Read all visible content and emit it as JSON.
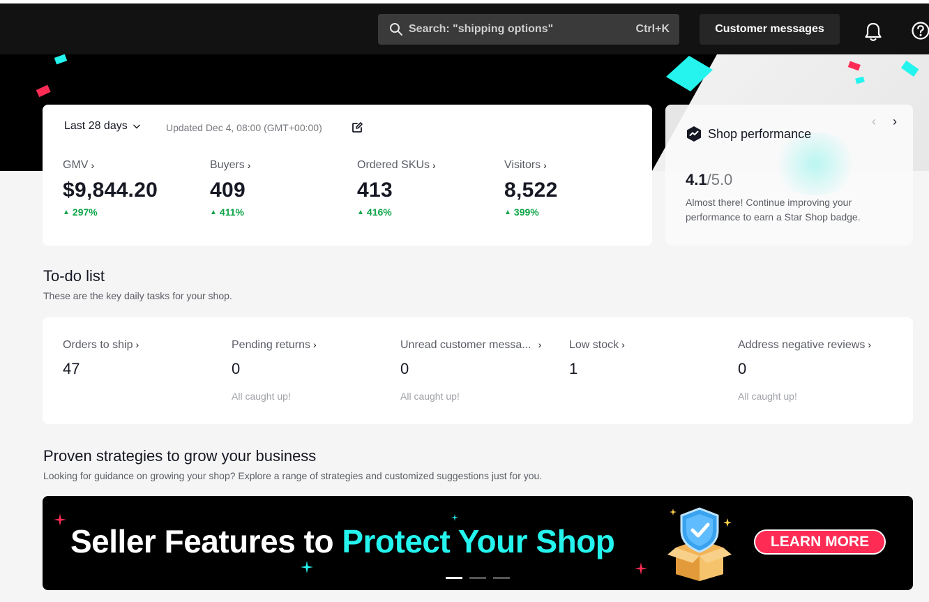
{
  "topbar": {
    "search_placeholder": "Search: \"shipping options\"",
    "search_shortcut": "Ctrl+K",
    "messages_label": "Customer messages",
    "icons": [
      "search-icon",
      "bell-icon",
      "help-icon"
    ]
  },
  "stats": {
    "range_label": "Last 28 days",
    "updated_label": "Updated Dec 4, 08:00 (GMT+00:00)",
    "metrics": [
      {
        "label": "GMV",
        "value": "$9,844.20",
        "delta": "297%"
      },
      {
        "label": "Buyers",
        "value": "409",
        "delta": "411%"
      },
      {
        "label": "Ordered SKUs",
        "value": "413",
        "delta": "416%"
      },
      {
        "label": "Visitors",
        "value": "8,522",
        "delta": "399%"
      }
    ]
  },
  "performance": {
    "title": "Shop performance",
    "score": "4.1",
    "max": "/5.0",
    "description": "Almost there! Continue improving your performance to earn a Star Shop badge."
  },
  "todo": {
    "title": "To-do list",
    "subtitle": "These are the key daily tasks for your shop.",
    "items": [
      {
        "label": "Orders to ship",
        "value": "47",
        "note": ""
      },
      {
        "label": "Pending returns",
        "value": "0",
        "note": "All caught up!"
      },
      {
        "label": "Unread customer messa...",
        "value": "0",
        "note": "All caught up!"
      },
      {
        "label": "Low stock",
        "value": "1",
        "note": ""
      },
      {
        "label": "Address negative reviews",
        "value": "0",
        "note": "All caught up!"
      }
    ]
  },
  "strategies": {
    "title": "Proven strategies to grow your business",
    "subtitle": "Looking for guidance on growing your shop? Explore a range of strategies and customized suggestions just for you.",
    "banner": {
      "text_white": "Seller Features to ",
      "text_cyan": "Protect Your Shop",
      "cta": "LEARN MORE",
      "slides": 3,
      "active_slide": 1
    }
  },
  "colors": {
    "accent_pink": "#fe2c55",
    "accent_cyan": "#25f4ee",
    "positive": "#0fa548"
  }
}
